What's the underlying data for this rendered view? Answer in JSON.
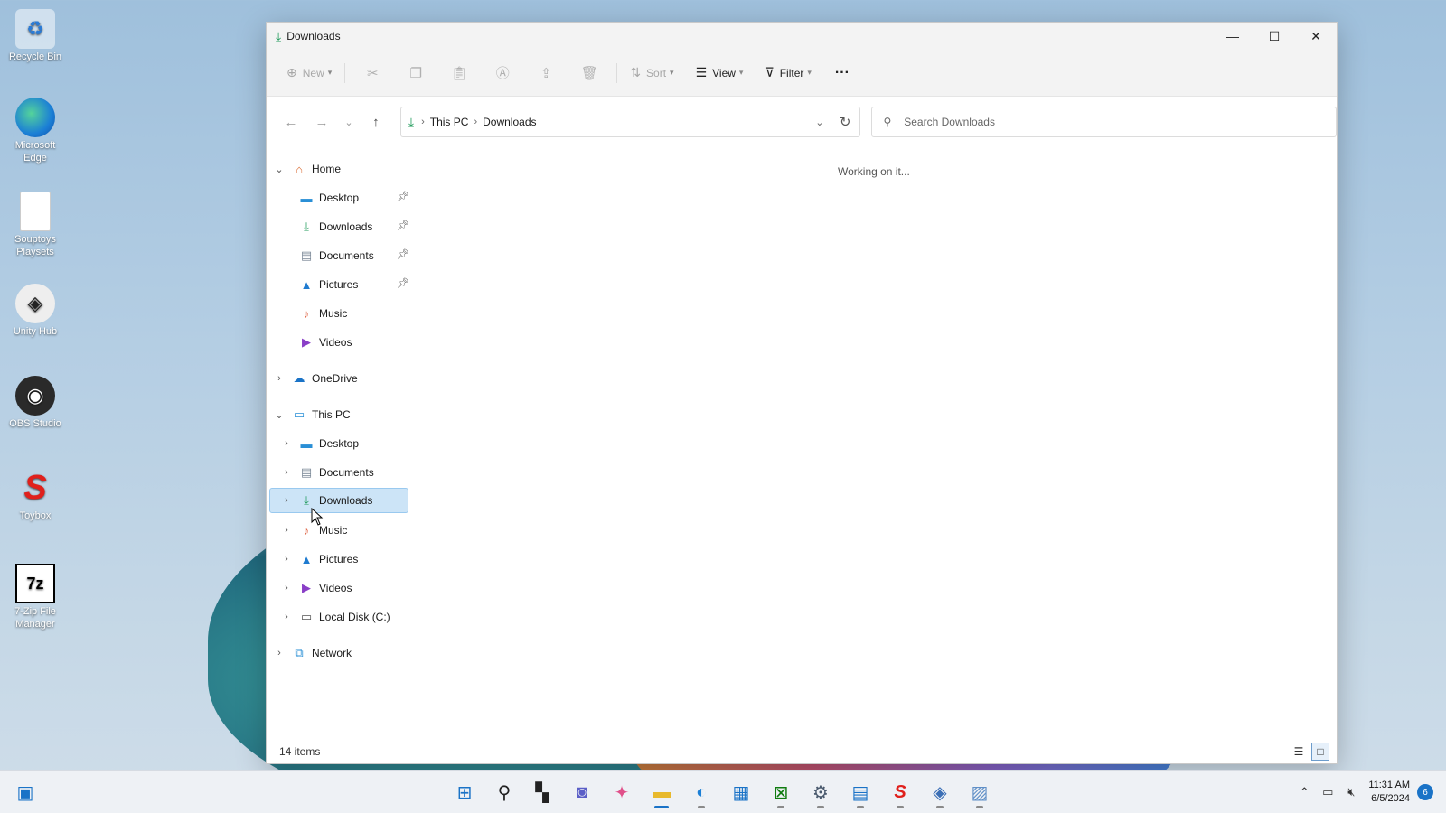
{
  "desktop": {
    "icons": [
      {
        "label": "Recycle Bin",
        "icon": "recycle-bin-icon"
      },
      {
        "label": "Microsoft Edge",
        "icon": "edge-icon"
      },
      {
        "label": "Souptoys Playsets",
        "icon": "file-icon"
      },
      {
        "label": "Unity Hub",
        "icon": "unity-icon"
      },
      {
        "label": "OBS Studio",
        "icon": "obs-icon"
      },
      {
        "label": "Toybox",
        "icon": "toybox-icon"
      },
      {
        "label": "7-Zip File Manager",
        "icon": "7zip-icon"
      }
    ]
  },
  "window": {
    "title": "Downloads",
    "controls": {
      "minimize": "—",
      "maximize": "☐",
      "close": "✕"
    }
  },
  "commandbar": {
    "new_label": "New",
    "sort_label": "Sort",
    "view_label": "View",
    "filter_label": "Filter",
    "more_label": "···"
  },
  "address": {
    "crumbs": [
      "This PC",
      "Downloads"
    ]
  },
  "search": {
    "placeholder": "Search Downloads"
  },
  "navpane": {
    "home": {
      "label": "Home",
      "items": [
        {
          "label": "Desktop",
          "icon": "desktop-icon",
          "pinned": true
        },
        {
          "label": "Downloads",
          "icon": "download-icon",
          "pinned": true
        },
        {
          "label": "Documents",
          "icon": "document-icon",
          "pinned": true
        },
        {
          "label": "Pictures",
          "icon": "pictures-icon",
          "pinned": true
        },
        {
          "label": "Music",
          "icon": "music-icon",
          "pinned": false
        },
        {
          "label": "Videos",
          "icon": "videos-icon",
          "pinned": false
        }
      ]
    },
    "onedrive": {
      "label": "OneDrive"
    },
    "thispc": {
      "label": "This PC",
      "items": [
        {
          "label": "Desktop",
          "icon": "desktop-icon"
        },
        {
          "label": "Documents",
          "icon": "document-icon"
        },
        {
          "label": "Downloads",
          "icon": "download-icon",
          "selected": true
        },
        {
          "label": "Music",
          "icon": "music-icon"
        },
        {
          "label": "Pictures",
          "icon": "pictures-icon"
        },
        {
          "label": "Videos",
          "icon": "videos-icon"
        },
        {
          "label": "Local Disk (C:)",
          "icon": "drive-icon"
        }
      ]
    },
    "network": {
      "label": "Network"
    }
  },
  "content": {
    "status_message": "Working on it..."
  },
  "statusbar": {
    "item_count": "14 items"
  },
  "taskbar": {
    "time": "11:31 AM",
    "date": "6/5/2024",
    "notification_count": "6"
  },
  "colors": {
    "accent": "#1a73c7",
    "selection_bg": "#cce4f7"
  }
}
